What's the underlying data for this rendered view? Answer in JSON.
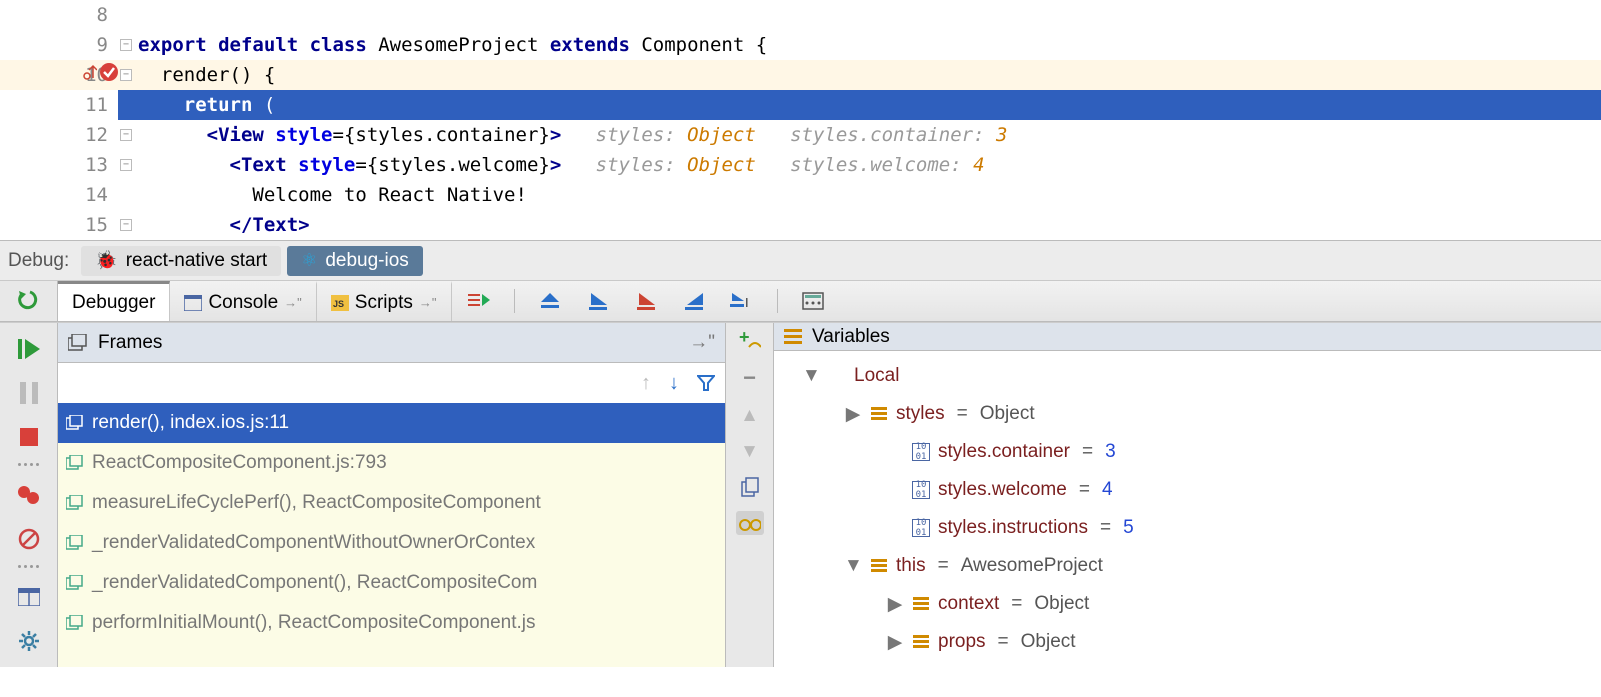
{
  "editor": {
    "lines": [
      {
        "num": "8",
        "hl": false,
        "sel": false,
        "fold": "",
        "marks": [],
        "seg": []
      },
      {
        "num": "9",
        "hl": false,
        "sel": false,
        "fold": "-",
        "marks": [],
        "seg": [
          [
            "k",
            "export "
          ],
          [
            "k",
            "default "
          ],
          [
            "k",
            "class "
          ],
          [
            "fn",
            "AwesomeProject "
          ],
          [
            "k",
            "extends "
          ],
          [
            "fn",
            "Component {"
          ]
        ]
      },
      {
        "num": "10",
        "hl": true,
        "sel": false,
        "fold": "-",
        "marks": [
          "up",
          "check"
        ],
        "seg": [
          [
            "txt",
            "  "
          ],
          [
            "fn",
            "render() {"
          ]
        ]
      },
      {
        "num": "11",
        "hl": false,
        "sel": true,
        "fold": "",
        "marks": [],
        "seg": [
          [
            "txt",
            "    "
          ],
          [
            "k",
            "return "
          ],
          [
            "txt",
            "("
          ]
        ]
      },
      {
        "num": "12",
        "hl": false,
        "sel": false,
        "fold": "-",
        "marks": [],
        "seg": [
          [
            "txt",
            "      "
          ],
          [
            "tag",
            "<View "
          ],
          [
            "attr",
            "style"
          ],
          [
            "txt",
            "="
          ],
          [
            "txt",
            "{styles.container}"
          ],
          [
            "tag",
            ">"
          ],
          [
            "txt",
            "   "
          ],
          [
            "hint",
            "styles: "
          ],
          [
            "hintv",
            "Object"
          ],
          [
            "hint",
            "   styles.container: "
          ],
          [
            "hintv",
            "3"
          ]
        ]
      },
      {
        "num": "13",
        "hl": false,
        "sel": false,
        "fold": "-",
        "marks": [],
        "seg": [
          [
            "txt",
            "        "
          ],
          [
            "tag",
            "<Text "
          ],
          [
            "attr",
            "style"
          ],
          [
            "txt",
            "="
          ],
          [
            "txt",
            "{styles.welcome}"
          ],
          [
            "tag",
            ">"
          ],
          [
            "txt",
            "   "
          ],
          [
            "hint",
            "styles: "
          ],
          [
            "hintv",
            "Object"
          ],
          [
            "hint",
            "   styles.welcome: "
          ],
          [
            "hintv",
            "4"
          ]
        ]
      },
      {
        "num": "14",
        "hl": false,
        "sel": false,
        "fold": "",
        "marks": [],
        "seg": [
          [
            "txt",
            "          Welcome to React Native!"
          ]
        ]
      },
      {
        "num": "15",
        "hl": false,
        "sel": false,
        "fold": "-",
        "marks": [],
        "seg": [
          [
            "txt",
            "        "
          ],
          [
            "tag",
            "</Text>"
          ]
        ]
      }
    ]
  },
  "debug": {
    "label": "Debug:",
    "tabs": [
      {
        "label": "react-native start",
        "active": false
      },
      {
        "label": "debug-ios",
        "active": true
      }
    ]
  },
  "toolbar": {
    "tabs": [
      {
        "label": "Debugger",
        "active": true
      },
      {
        "label": "Console",
        "active": false
      },
      {
        "label": "Scripts",
        "active": false
      }
    ]
  },
  "frames": {
    "title": "Frames",
    "items": [
      {
        "label": "render(), index.ios.js:11",
        "sel": true
      },
      {
        "label": "ReactCompositeComponent.js:793",
        "sel": false
      },
      {
        "label": "measureLifeCyclePerf(), ReactCompositeComponent",
        "sel": false
      },
      {
        "label": "_renderValidatedComponentWithoutOwnerOrContex",
        "sel": false
      },
      {
        "label": "_renderValidatedComponent(), ReactCompositeCom",
        "sel": false
      },
      {
        "label": "performInitialMount(), ReactCompositeComponent.js",
        "sel": false
      }
    ]
  },
  "vars": {
    "title": "Variables",
    "tree": [
      {
        "ind": 1,
        "tw": "▼",
        "icon": "",
        "name": "Local",
        "val": "",
        "num": false
      },
      {
        "ind": 2,
        "tw": "▶",
        "icon": "obj",
        "name": "styles",
        "val": "Object",
        "num": false
      },
      {
        "ind": 3,
        "tw": "",
        "icon": "num",
        "name": "styles.container",
        "val": "3",
        "num": true
      },
      {
        "ind": 3,
        "tw": "",
        "icon": "num",
        "name": "styles.welcome",
        "val": "4",
        "num": true
      },
      {
        "ind": 3,
        "tw": "",
        "icon": "num",
        "name": "styles.instructions",
        "val": "5",
        "num": true
      },
      {
        "ind": 2,
        "tw": "▼",
        "icon": "obj",
        "name": "this",
        "val": "AwesomeProject",
        "num": false
      },
      {
        "ind": 3,
        "tw": "▶",
        "icon": "obj",
        "name": "context",
        "val": "Object",
        "num": false
      },
      {
        "ind": 3,
        "tw": "▶",
        "icon": "obj",
        "name": "props",
        "val": "Object",
        "num": false
      }
    ]
  }
}
